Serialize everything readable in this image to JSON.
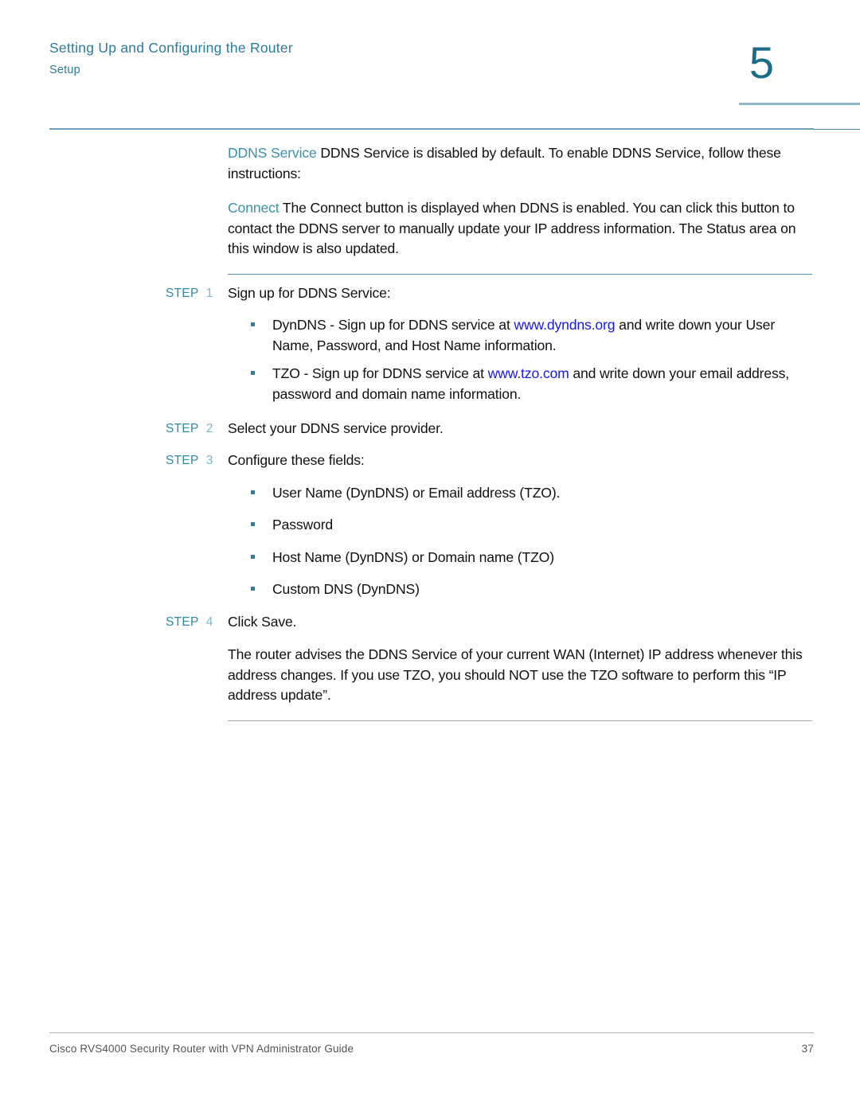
{
  "header": {
    "title": "Setting Up and Configuring the Router",
    "subtitle": "Setup",
    "chapter_number": "5"
  },
  "colors": {
    "teal": "#2b7c9b",
    "heading_teal": "#3c90ad",
    "step_label": "#2e8aa6",
    "step_number": "#7fb7c7",
    "link_blue": "#1818e8",
    "rule_teal": "#4f96ad",
    "rule_gray": "#a8a8a8",
    "chapter_number": "#1b6d85",
    "body_text": "#111111",
    "footer_text": "#555555"
  },
  "intro": {
    "para1": {
      "term": "DDNS Service",
      "text": "DDNS Service is disabled by default. To enable DDNS Service, follow these instructions:"
    },
    "para2": {
      "term": "Connect",
      "text": "The Connect button is displayed when DDNS is enabled. You can click this button to contact the DDNS server to manually update your IP address information. The Status area on this window is also updated."
    }
  },
  "steps": [
    {
      "label": "STEP",
      "number": "1",
      "text": "Sign up for DDNS Service:"
    },
    {
      "label": "STEP",
      "number": "2",
      "text": "Select your DDNS service provider."
    },
    {
      "label": "STEP",
      "number": "3",
      "text": "Configure these fields:"
    },
    {
      "label": "STEP",
      "number": "4",
      "text": "Click Save."
    }
  ],
  "bullets_step1": [
    {
      "before": "DynDNS - Sign up for DDNS service at ",
      "link": "www.dyndns.org",
      "after": " and write down your User Name, Password, and Host Name information."
    },
    {
      "before": "TZO - Sign up for DDNS service at ",
      "link": "www.tzo.com",
      "after": " and write down your email address, password and domain name information."
    }
  ],
  "bullets_step3": [
    {
      "text": "User Name (DynDNS) or Email address (TZO)."
    },
    {
      "text": "Password"
    },
    {
      "text": "Host Name (DynDNS) or Domain name (TZO)"
    },
    {
      "text": "Custom DNS (DynDNS)"
    }
  ],
  "closing": {
    "text": "The router advises the DDNS Service of your current WAN (Internet) IP address whenever this address changes. If you use TZO, you should NOT use the TZO software to perform this “IP address update”."
  },
  "footer": {
    "document_title": "Cisco RVS4000 Security Router with VPN Administrator Guide",
    "page_number": "37"
  }
}
